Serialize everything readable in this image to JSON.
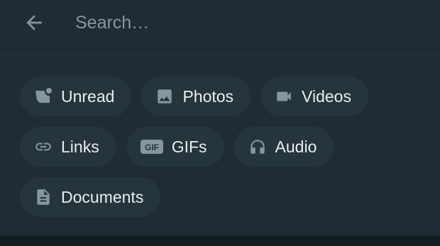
{
  "header": {
    "back_icon": "arrow-left-icon",
    "search_placeholder": "Search…"
  },
  "filters": [
    {
      "label": "Unread",
      "icon": "unread-chat-icon"
    },
    {
      "label": "Photos",
      "icon": "image-icon"
    },
    {
      "label": "Videos",
      "icon": "video-camera-icon"
    },
    {
      "label": "Links",
      "icon": "link-icon"
    },
    {
      "label": "GIFs",
      "icon": "gif-icon"
    },
    {
      "label": "Audio",
      "icon": "headphones-icon"
    },
    {
      "label": "Documents",
      "icon": "document-icon"
    }
  ],
  "colors": {
    "background": "#1f2c34",
    "chip_background": "#26343c",
    "icon": "#8696a0",
    "text": "#e9edef",
    "placeholder": "#8696a0"
  }
}
